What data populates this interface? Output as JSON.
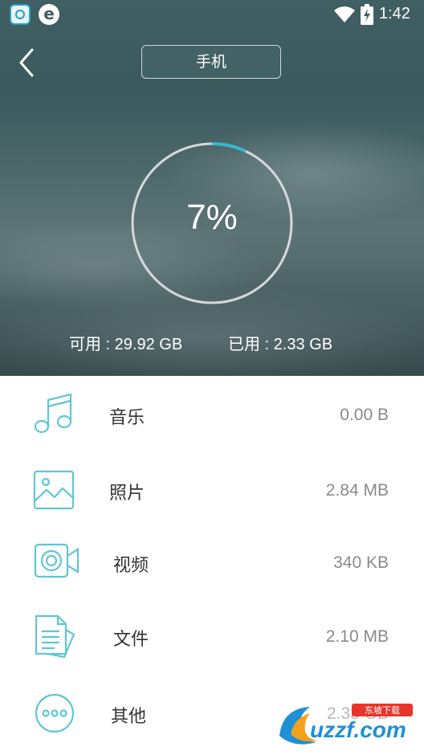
{
  "status_bar": {
    "time": "1:42",
    "left_icons": [
      "clean-app-icon",
      "e-app-icon"
    ],
    "right_icons": [
      "wifi-icon",
      "battery-charging-icon"
    ]
  },
  "header": {
    "back_icon": "chevron-left-icon",
    "device_label": "手机"
  },
  "storage": {
    "percent_text": "7%",
    "percent_value": 7,
    "available_text": "可用 : 29.92 GB",
    "used_text": "已用 : 2.33 GB"
  },
  "categories": [
    {
      "label": "音乐",
      "size": "0.00 B",
      "icon": "music-icon"
    },
    {
      "label": "照片",
      "size": "2.84 MB",
      "icon": "photo-icon"
    },
    {
      "label": "视频",
      "size": "340 KB",
      "icon": "video-icon"
    },
    {
      "label": "文件",
      "size": "2.10 MB",
      "icon": "document-icon"
    },
    {
      "label": "其他",
      "size": "2.33 GB",
      "icon": "more-icon"
    }
  ],
  "colors": {
    "accent": "#3bb7c9",
    "icon_stroke": "#5fc6d3",
    "hero_bg": "#4a6467",
    "text_dark": "#333333",
    "text_muted": "#8a8a8a"
  },
  "watermark": {
    "brand": "uzzf.com",
    "tagline": "东坡下载"
  }
}
